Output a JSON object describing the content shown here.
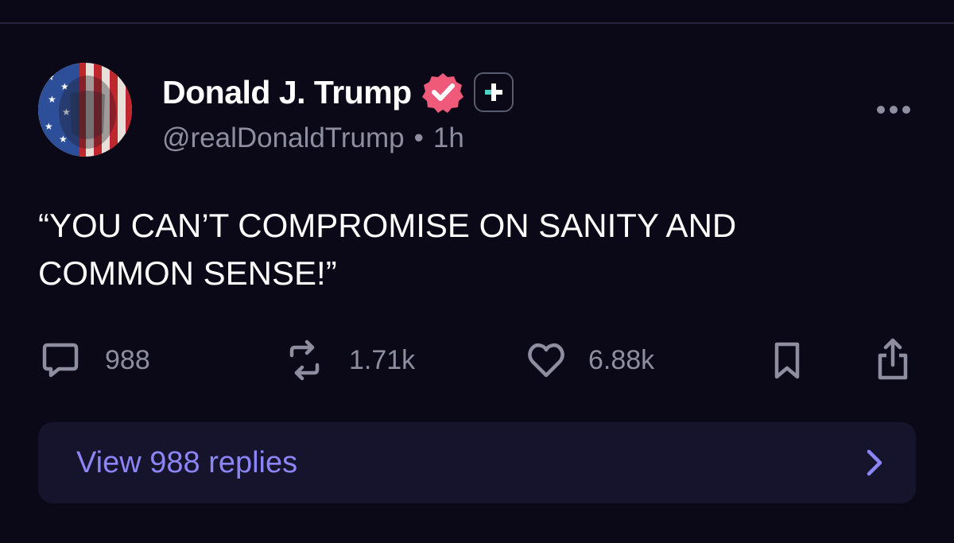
{
  "post": {
    "author": {
      "display_name": "Donald J. Trump",
      "handle": "@realDonaldTrump",
      "verified_icon": "verified-check-badge-icon",
      "plus_icon": "plus-badge-icon"
    },
    "separator": "•",
    "time_ago": "1h",
    "text": "“YOU CAN’T COMPROMISE ON SANITY AND\nCOMMON SENSE!”",
    "stats": {
      "replies": "988",
      "reposts": "1.71k",
      "likes": "6.88k"
    },
    "icons": {
      "more": "more-options-icon",
      "reply": "comment-icon",
      "repost": "repost-icon",
      "like": "heart-icon",
      "bookmark": "bookmark-icon",
      "share": "share-icon",
      "chevron": "chevron-right-icon"
    },
    "view_replies_label": "View 988 replies"
  },
  "colors": {
    "background": "#0b0817",
    "divider": "#25223a",
    "text_primary": "#ffffff",
    "text_secondary": "#8e8ea0",
    "accent": "#8b85f5",
    "verified": "#ef5a7a",
    "panel": "#16132c"
  }
}
